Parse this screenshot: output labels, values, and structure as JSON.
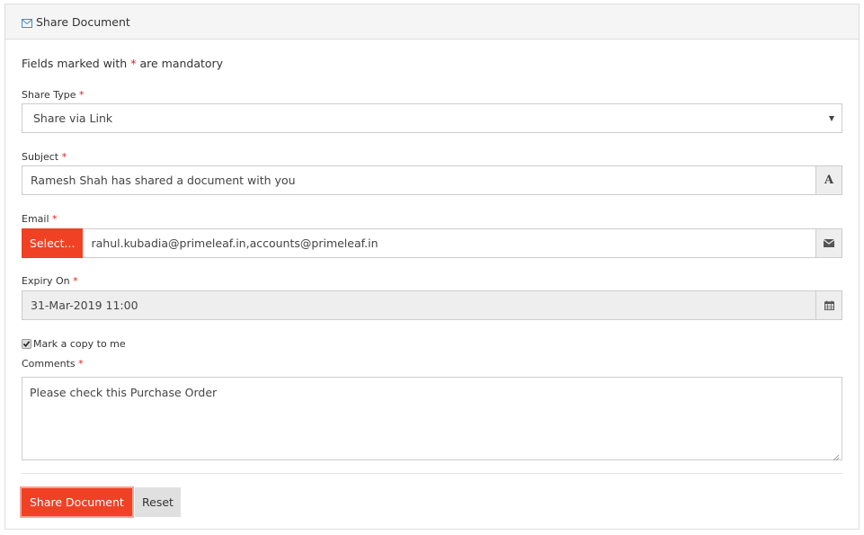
{
  "panel": {
    "title": "Share Document",
    "title_icon": "envelope-outline-icon"
  },
  "form": {
    "mandatory_note_prefix": "Fields marked with",
    "mandatory_note_star": "*",
    "mandatory_note_suffix": "are mandatory",
    "required_marker": "*",
    "share_type": {
      "label": "Share Type",
      "value": "Share via Link",
      "icon": "caret-down-icon"
    },
    "subject": {
      "label": "Subject",
      "value": "Ramesh Shah has shared a document with you",
      "addon_text": "A",
      "addon_icon": "font-icon"
    },
    "email": {
      "label": "Email",
      "select_button": "Select...",
      "value": "rahul.kubadia@primeleaf.in,accounts@primeleaf.in",
      "addon_icon": "envelope-icon"
    },
    "expiry": {
      "label": "Expiry On",
      "value": "31-Mar-2019 11:00",
      "addon_icon": "calendar-icon"
    },
    "copy_to_me": {
      "label": "Mark a copy to me",
      "checked": true
    },
    "comments": {
      "label": "Comments",
      "value": "Please check this Purchase Order"
    }
  },
  "actions": {
    "submit_label": "Share Document",
    "reset_label": "Reset"
  },
  "colors": {
    "primary": "#f04124",
    "required": "#e02020",
    "icon_blue": "#3a8fd1"
  }
}
